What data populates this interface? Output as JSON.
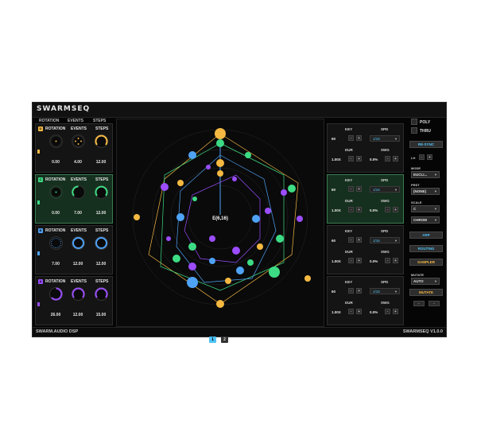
{
  "app": {
    "title": "SWARMSEQ",
    "footer_left": "SWARM.AUDIO DSP",
    "footer_right": "SWARMSEQ V1.0.0"
  },
  "headers": [
    "ROTATION",
    "EVENTS",
    "STEPS"
  ],
  "tracks": [
    {
      "id": "D",
      "color": "#f5b942",
      "labels": [
        "ROTATION",
        "EVENTS",
        "STEPS"
      ],
      "values": [
        "0.00",
        "4.00",
        "12.00"
      ]
    },
    {
      "id": "C",
      "color": "#3ddc84",
      "labels": [
        "ROTATION",
        "EVENTS",
        "STEPS"
      ],
      "values": [
        "0.00",
        "7.00",
        "12.00"
      ]
    },
    {
      "id": "B",
      "color": "#4fa3f7",
      "labels": [
        "ROTATION",
        "EVENTS",
        "STEPS"
      ],
      "values": [
        "7.00",
        "12.00",
        "12.00"
      ]
    },
    {
      "id": "A",
      "color": "#9b4dff",
      "labels": [
        "ROTATION",
        "EVENTS",
        "STEPS"
      ],
      "values": [
        "26.00",
        "12.00",
        "15.00"
      ]
    }
  ],
  "center_label": "E(6,16)",
  "pages": [
    "1",
    "2"
  ],
  "controls": [
    {
      "key_label": "KEY",
      "spd_label": "SPD",
      "key": "60",
      "spd": "1/16",
      "dur_label": "DUR",
      "swg_label": "SWG",
      "dur": "1.00X",
      "swg": "0.0%"
    },
    {
      "key_label": "KEY",
      "spd_label": "SPD",
      "key": "60",
      "spd": "1/16",
      "dur_label": "DUR",
      "swg_label": "SWG",
      "dur": "1.00X",
      "swg": "0.0%"
    },
    {
      "key_label": "KEY",
      "spd_label": "SPD",
      "key": "60",
      "spd": "1/16",
      "dur_label": "DUR",
      "swg_label": "SWG",
      "dur": "1.00X",
      "swg": "0.0%"
    },
    {
      "key_label": "KEY",
      "spd_label": "SPD",
      "key": "60",
      "spd": "1/16",
      "dur_label": "DUR",
      "swg_label": "SWG",
      "dur": "1.00X",
      "swg": "0.0%"
    }
  ],
  "right": {
    "poly": "POLY",
    "thru": "THRU",
    "resync": "RE-SYNC",
    "lh": "LH",
    "mode_label": "MODE",
    "mode": "EUCLI...",
    "pr_label": "PRST",
    "pr": "(NONE)",
    "scale_label": "SCALE",
    "scale_root": "C",
    "scale": "CHROM",
    "arp": "ARP",
    "routing": "ROUTING",
    "sampler": "SAMPLER",
    "mutate_label": "MUTATE",
    "mutate_mode": "AUTO",
    "mutate_btn": "MUTATE"
  },
  "buttons": {
    "minus": "-",
    "plus": "+"
  },
  "colors": {
    "d": "#f5b942",
    "c": "#3ddc84",
    "b": "#4fa3f7",
    "a": "#9b4dff",
    "accent": "#4fc3f7"
  }
}
